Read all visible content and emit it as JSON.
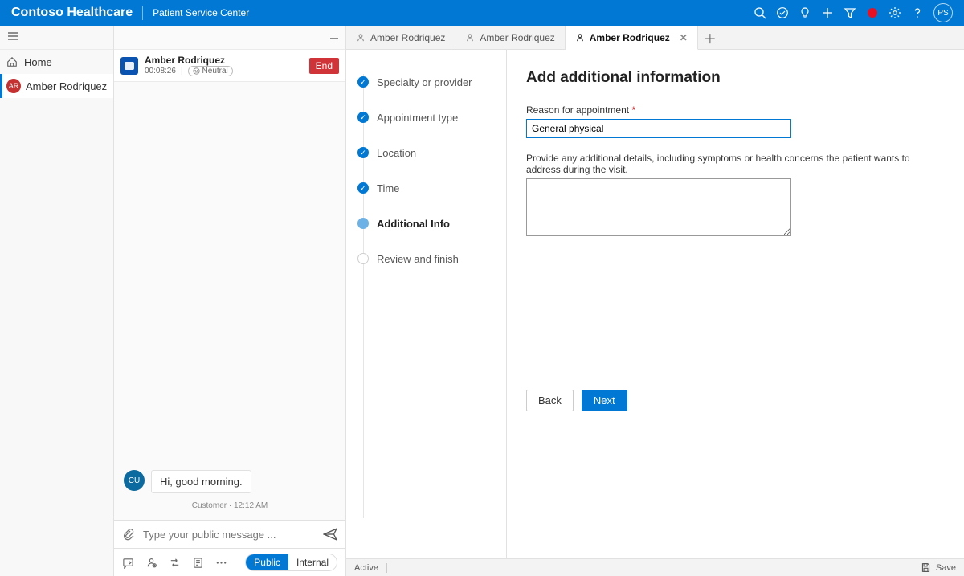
{
  "topbar": {
    "brand": "Contoso Healthcare",
    "subtitle": "Patient Service Center",
    "avatar_initials": "PS"
  },
  "leftnav": {
    "home": "Home",
    "patient": {
      "initials": "AR",
      "name": "Amber Rodriquez"
    }
  },
  "chat": {
    "header": {
      "name": "Amber Rodriquez",
      "timer": "00:08:26",
      "sentiment": "Neutral",
      "end": "End"
    },
    "message": {
      "sender_initials": "CU",
      "text": "Hi, good morning."
    },
    "meta": "Customer · 12:12 AM",
    "input_placeholder": "Type your public message ...",
    "pill_public": "Public",
    "pill_internal": "Internal"
  },
  "tabs": {
    "t1": "Amber Rodriquez",
    "t2": "Amber Rodriquez",
    "t3": "Amber Rodriquez"
  },
  "steps": {
    "s1": "Specialty or provider",
    "s2": "Appointment type",
    "s3": "Location",
    "s4": "Time",
    "s5": "Additional Info",
    "s6": "Review and finish"
  },
  "form": {
    "heading": "Add additional information",
    "reason_label": "Reason for appointment",
    "reason_value": "General physical",
    "details_label": "Provide any additional details, including symptoms or health concerns the patient wants to address during the visit.",
    "details_value": "",
    "back": "Back",
    "next": "Next"
  },
  "statusbar": {
    "active": "Active",
    "save": "Save"
  }
}
